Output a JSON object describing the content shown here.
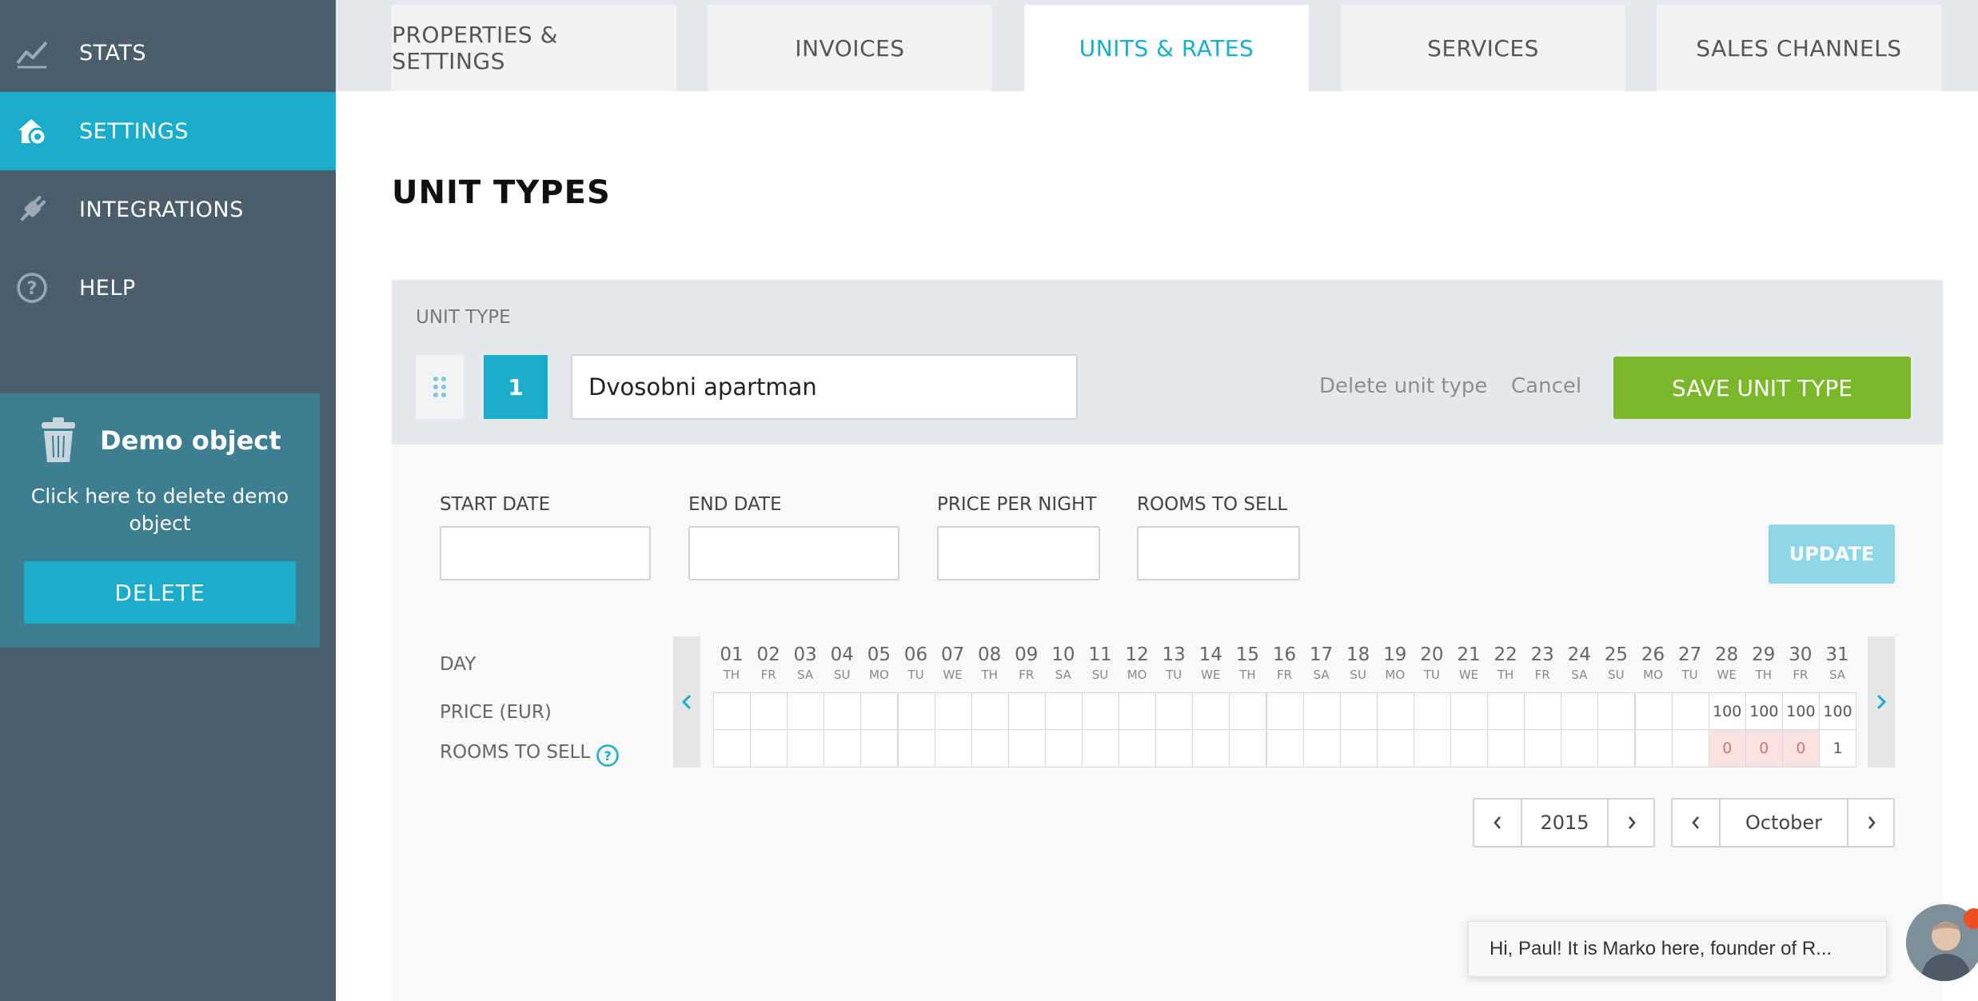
{
  "sidebar": {
    "items": [
      {
        "label": "STATS",
        "icon": "stats-chart-icon"
      },
      {
        "label": "SETTINGS",
        "icon": "settings-house-gear-icon",
        "active": true
      },
      {
        "label": "INTEGRATIONS",
        "icon": "plug-icon"
      },
      {
        "label": "HELP",
        "icon": "help-circle-icon"
      }
    ],
    "demo": {
      "title": "Demo object",
      "text": "Click here to delete demo object",
      "delete_label": "DELETE"
    }
  },
  "tabs": [
    {
      "label": "PROPERTIES & SETTINGS"
    },
    {
      "label": "INVOICES"
    },
    {
      "label": "UNITS & RATES",
      "active": true
    },
    {
      "label": "SERVICES"
    },
    {
      "label": "SALES CHANNELS"
    }
  ],
  "page": {
    "title": "UNIT TYPES"
  },
  "unit": {
    "label": "UNIT TYPE",
    "number": "1",
    "name": "Dvosobni apartman",
    "delete_label": "Delete unit type",
    "cancel_label": "Cancel",
    "save_label": "SAVE UNIT TYPE"
  },
  "form": {
    "start_date_label": "START DATE",
    "end_date_label": "END DATE",
    "price_label": "PRICE PER NIGHT",
    "rooms_label": "ROOMS TO SELL",
    "update_label": "UPDATE"
  },
  "calendar": {
    "day_label": "DAY",
    "price_label": "PRICE (EUR)",
    "rooms_label": "ROOMS TO SELL",
    "days": [
      {
        "n": "01",
        "d": "TH"
      },
      {
        "n": "02",
        "d": "FR"
      },
      {
        "n": "03",
        "d": "SA"
      },
      {
        "n": "04",
        "d": "SU"
      },
      {
        "n": "05",
        "d": "MO"
      },
      {
        "n": "06",
        "d": "TU"
      },
      {
        "n": "07",
        "d": "WE"
      },
      {
        "n": "08",
        "d": "TH"
      },
      {
        "n": "09",
        "d": "FR"
      },
      {
        "n": "10",
        "d": "SA"
      },
      {
        "n": "11",
        "d": "SU"
      },
      {
        "n": "12",
        "d": "MO"
      },
      {
        "n": "13",
        "d": "TU"
      },
      {
        "n": "14",
        "d": "WE"
      },
      {
        "n": "15",
        "d": "TH"
      },
      {
        "n": "16",
        "d": "FR"
      },
      {
        "n": "17",
        "d": "SA"
      },
      {
        "n": "18",
        "d": "SU"
      },
      {
        "n": "19",
        "d": "MO"
      },
      {
        "n": "20",
        "d": "TU"
      },
      {
        "n": "21",
        "d": "WE"
      },
      {
        "n": "22",
        "d": "TH"
      },
      {
        "n": "23",
        "d": "FR"
      },
      {
        "n": "24",
        "d": "SA"
      },
      {
        "n": "25",
        "d": "SU"
      },
      {
        "n": "26",
        "d": "MO"
      },
      {
        "n": "27",
        "d": "TU"
      },
      {
        "n": "28",
        "d": "WE"
      },
      {
        "n": "29",
        "d": "TH"
      },
      {
        "n": "30",
        "d": "FR"
      },
      {
        "n": "31",
        "d": "SA"
      }
    ],
    "prices": [
      "",
      "",
      "",
      "",
      "",
      "",
      "",
      "",
      "",
      "",
      "",
      "",
      "",
      "",
      "",
      "",
      "",
      "",
      "",
      "",
      "",
      "",
      "",
      "",
      "",
      "",
      "",
      "100",
      "100",
      "100",
      "100"
    ],
    "rooms": [
      "",
      "",
      "",
      "",
      "",
      "",
      "",
      "",
      "",
      "",
      "",
      "",
      "",
      "",
      "",
      "",
      "",
      "",
      "",
      "",
      "",
      "",
      "",
      "",
      "",
      "",
      "",
      "0",
      "0",
      "0",
      "1"
    ],
    "year": "2015",
    "month": "October"
  },
  "chat": {
    "message": "Hi, Paul! It is Marko here, founder of R..."
  },
  "colors": {
    "sidebar_bg": "#4a5e6c",
    "accent": "#1aaccb",
    "save_green": "#7ab829",
    "unavailable_pink": "#fbe2e2"
  }
}
